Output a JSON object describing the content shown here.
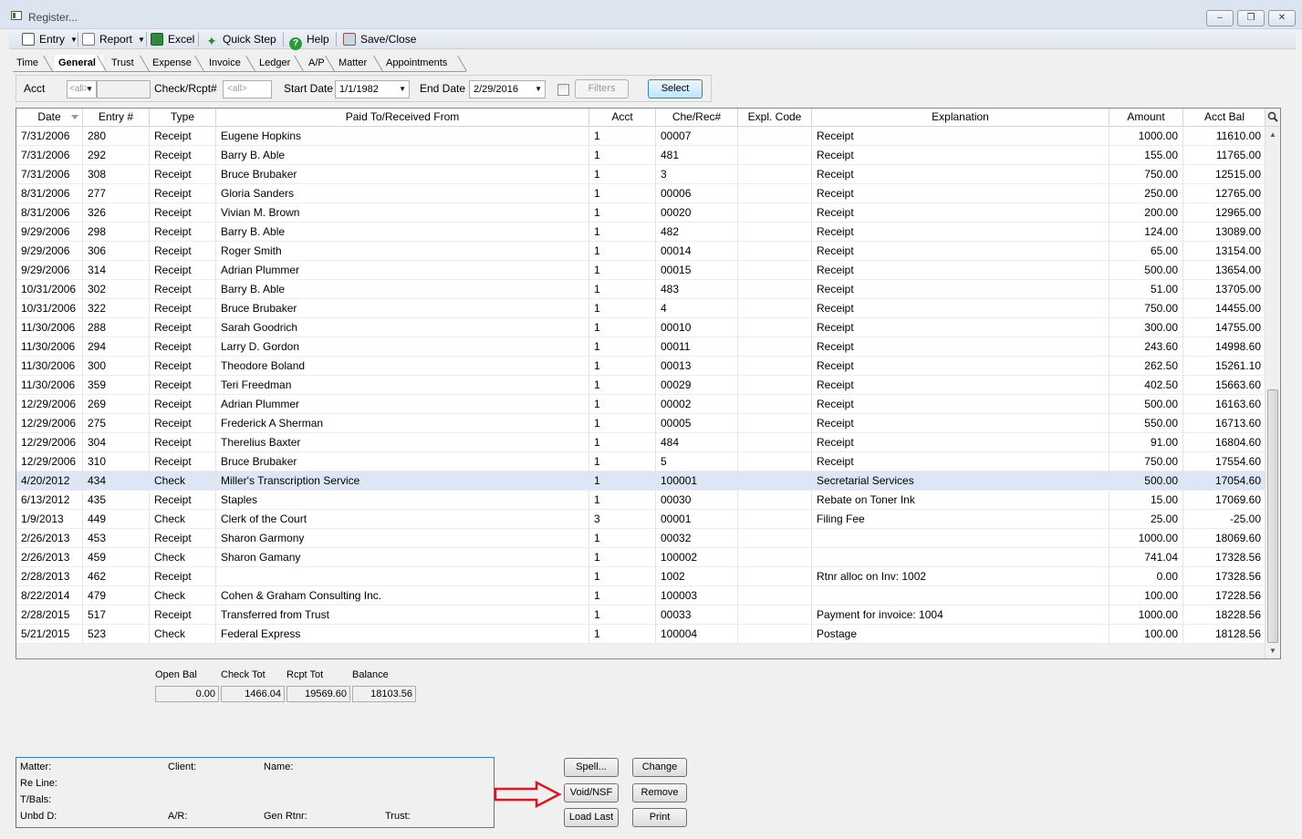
{
  "window": {
    "title": "Register..."
  },
  "toolbar": {
    "entry": "Entry",
    "report": "Report",
    "excel": "Excel",
    "quick_step": "Quick Step",
    "help": "Help",
    "save_close": "Save/Close"
  },
  "tabs": [
    "Time",
    "General",
    "Trust",
    "Expense",
    "Invoice",
    "Ledger",
    "A/P",
    "Matter",
    "Appointments"
  ],
  "active_tab": "General",
  "filters": {
    "acct_label": "Acct",
    "acct_value": "<all>",
    "check_rcpt_label": "Check/Rcpt#",
    "check_rcpt_value": "<all>",
    "start_date_label": "Start Date",
    "start_date_value": "1/1/1982",
    "end_date_label": "End Date",
    "end_date_value": "2/29/2016",
    "filters_button": "Filters",
    "select_button": "Select"
  },
  "grid": {
    "columns": [
      "Date",
      "Entry #",
      "Type",
      "Paid To/Received From",
      "Acct",
      "Che/Rec#",
      "Expl. Code",
      "Explanation",
      "Amount",
      "Acct Bal"
    ],
    "rows": [
      [
        "7/31/2006",
        "280",
        "Receipt",
        "Eugene Hopkins",
        "1",
        "00007",
        "",
        "Receipt",
        "1000.00",
        "11610.00"
      ],
      [
        "7/31/2006",
        "292",
        "Receipt",
        "Barry B. Able",
        "1",
        "481",
        "",
        "Receipt",
        "155.00",
        "11765.00"
      ],
      [
        "7/31/2006",
        "308",
        "Receipt",
        "Bruce Brubaker",
        "1",
        "3",
        "",
        "Receipt",
        "750.00",
        "12515.00"
      ],
      [
        "8/31/2006",
        "277",
        "Receipt",
        "Gloria Sanders",
        "1",
        "00006",
        "",
        "Receipt",
        "250.00",
        "12765.00"
      ],
      [
        "8/31/2006",
        "326",
        "Receipt",
        "Vivian M. Brown",
        "1",
        "00020",
        "",
        "Receipt",
        "200.00",
        "12965.00"
      ],
      [
        "9/29/2006",
        "298",
        "Receipt",
        "Barry B. Able",
        "1",
        "482",
        "",
        "Receipt",
        "124.00",
        "13089.00"
      ],
      [
        "9/29/2006",
        "306",
        "Receipt",
        "Roger Smith",
        "1",
        "00014",
        "",
        "Receipt",
        "65.00",
        "13154.00"
      ],
      [
        "9/29/2006",
        "314",
        "Receipt",
        "Adrian Plummer",
        "1",
        "00015",
        "",
        "Receipt",
        "500.00",
        "13654.00"
      ],
      [
        "10/31/2006",
        "302",
        "Receipt",
        "Barry B. Able",
        "1",
        "483",
        "",
        "Receipt",
        "51.00",
        "13705.00"
      ],
      [
        "10/31/2006",
        "322",
        "Receipt",
        "Bruce Brubaker",
        "1",
        "4",
        "",
        "Receipt",
        "750.00",
        "14455.00"
      ],
      [
        "11/30/2006",
        "288",
        "Receipt",
        "Sarah Goodrich",
        "1",
        "00010",
        "",
        "Receipt",
        "300.00",
        "14755.00"
      ],
      [
        "11/30/2006",
        "294",
        "Receipt",
        "Larry D. Gordon",
        "1",
        "00011",
        "",
        "Receipt",
        "243.60",
        "14998.60"
      ],
      [
        "11/30/2006",
        "300",
        "Receipt",
        "Theodore Boland",
        "1",
        "00013",
        "",
        "Receipt",
        "262.50",
        "15261.10"
      ],
      [
        "11/30/2006",
        "359",
        "Receipt",
        "Teri Freedman",
        "1",
        "00029",
        "",
        "Receipt",
        "402.50",
        "15663.60"
      ],
      [
        "12/29/2006",
        "269",
        "Receipt",
        "Adrian Plummer",
        "1",
        "00002",
        "",
        "Receipt",
        "500.00",
        "16163.60"
      ],
      [
        "12/29/2006",
        "275",
        "Receipt",
        "Frederick A Sherman",
        "1",
        "00005",
        "",
        "Receipt",
        "550.00",
        "16713.60"
      ],
      [
        "12/29/2006",
        "304",
        "Receipt",
        "Therelius Baxter",
        "1",
        "484",
        "",
        "Receipt",
        "91.00",
        "16804.60"
      ],
      [
        "12/29/2006",
        "310",
        "Receipt",
        "Bruce Brubaker",
        "1",
        "5",
        "",
        "Receipt",
        "750.00",
        "17554.60"
      ],
      [
        "4/20/2012",
        "434",
        "Check",
        "Miller's Transcription Service",
        "1",
        "100001",
        "",
        "Secretarial Services",
        "500.00",
        "17054.60"
      ],
      [
        "6/13/2012",
        "435",
        "Receipt",
        "Staples",
        "1",
        "00030",
        "",
        "Rebate on Toner Ink",
        "15.00",
        "17069.60"
      ],
      [
        "1/9/2013",
        "449",
        "Check",
        "Clerk of the Court",
        "3",
        "00001",
        "",
        "Filing Fee",
        "25.00",
        "-25.00"
      ],
      [
        "2/26/2013",
        "453",
        "Receipt",
        "Sharon Garmony",
        "1",
        "00032",
        "",
        "",
        "1000.00",
        "18069.60"
      ],
      [
        "2/26/2013",
        "459",
        "Check",
        "Sharon Gamany",
        "1",
        "100002",
        "",
        "",
        "741.04",
        "17328.56"
      ],
      [
        "2/28/2013",
        "462",
        "Receipt",
        "",
        "1",
        "1002",
        "",
        "Rtnr alloc on Inv: 1002",
        "0.00",
        "17328.56"
      ],
      [
        "8/22/2014",
        "479",
        "Check",
        "Cohen & Graham  Consulting Inc.",
        "1",
        "100003",
        "",
        "",
        "100.00",
        "17228.56"
      ],
      [
        "2/28/2015",
        "517",
        "Receipt",
        "Transferred from Trust",
        "1",
        "00033",
        "",
        "Payment for invoice: 1004",
        "1000.00",
        "18228.56"
      ],
      [
        "5/21/2015",
        "523",
        "Check",
        "Federal Express",
        "1",
        "100004",
        "",
        "Postage",
        "100.00",
        "18128.56"
      ]
    ],
    "selected_row": 18
  },
  "totals": {
    "open_bal_label": "Open Bal",
    "open_bal": "0.00",
    "check_tot_label": "Check Tot",
    "check_tot": "1466.04",
    "rcpt_tot_label": "Rcpt Tot",
    "rcpt_tot": "19569.60",
    "balance_label": "Balance",
    "balance": "18103.56"
  },
  "info": {
    "matter": "Matter:",
    "client": "Client:",
    "name": "Name:",
    "re_line": "Re Line:",
    "t_bals": "T/Bals:",
    "unbd_d": "Unbd D:",
    "ar": "A/R:",
    "gen_rtnr": "Gen Rtnr:",
    "trust": "Trust:"
  },
  "actions": {
    "spell": "Spell...",
    "change": "Change",
    "void_nsf": "Void/NSF",
    "remove": "Remove",
    "load_last": "Load Last",
    "print": "Print"
  },
  "colors": {
    "arrow": "#e0141e",
    "selected_row": "#dce6f4"
  }
}
